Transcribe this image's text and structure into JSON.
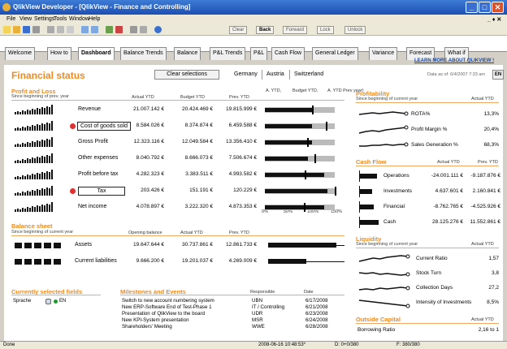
{
  "window": {
    "title": "QlikView Developer - [QlikView - Finance and Controlling]"
  },
  "menu": [
    "File",
    "View",
    "Settings",
    "Tools",
    "Window",
    "Help"
  ],
  "toolbar": {
    "clear": "Clear",
    "back": "Back",
    "forward": "Forward",
    "lock": "Lock",
    "unlock": "Unlock"
  },
  "tabs": [
    "Welcome",
    "How to",
    "Dashboard",
    "Balance Trends",
    "Balance",
    "P&L Trends",
    "P&L",
    "Cash Flow",
    "General Ledger",
    "Variance",
    "Forecast",
    "What if"
  ],
  "learn_more": "LEARN MORE ABOUT QLIKVIEW !",
  "header": {
    "title": "Financial status",
    "clear_btn": "Clear selections",
    "countries": [
      "Germany",
      "Austria",
      "Switzerland"
    ],
    "date_as_of": "Data as of: 6/4/2007 7:33 am",
    "lang": "EN"
  },
  "pl": {
    "title": "Profit and Loss",
    "subtitle": "Since beginning of prev. year",
    "cols": [
      "Actual YTD",
      "Budget YTD",
      "Prev. YTD"
    ],
    "legend": [
      "A. YTD,",
      "Budget YTD,",
      "A. YTD Prev year)"
    ],
    "rows": [
      {
        "label": "Revenue",
        "actual": "21.007.142 €",
        "budget": "20.424.469 €",
        "prev": "19.815.999 €",
        "pct": 1.03,
        "mk": 1.01
      },
      {
        "label": "Cost of goods sold",
        "actual": "8.584.026 €",
        "budget": "8.374.874 €",
        "prev": "6.459.588 €",
        "pct": 1.02,
        "mk": 1.3
      },
      {
        "label": "Gross Profit",
        "actual": "12.323.116 €",
        "budget": "12.049.584 €",
        "prev": "13.356.410 €",
        "pct": 1.02,
        "mk": 0.9
      },
      {
        "label": "Other expenses",
        "actual": "8.040.792 €",
        "budget": "8.666.073 €",
        "prev": "7.506.674 €",
        "pct": 0.93,
        "mk": 1.07
      },
      {
        "label": "Profit before tax",
        "actual": "4.282.323 €",
        "budget": "3.383.511 €",
        "prev": "4.993.582 €",
        "pct": 1.27,
        "mk": 0.86
      },
      {
        "label": "Tax",
        "actual": "203.426 €",
        "budget": "151.191 €",
        "prev": "120.229 €",
        "pct": 1.35,
        "mk": 1.68
      },
      {
        "label": "Net income",
        "actual": "4.078.897 €",
        "budget": "3.222.320 €",
        "prev": "4.873.353 €",
        "pct": 1.27,
        "mk": 0.84
      }
    ],
    "axis": [
      "0%",
      "50%",
      "100%",
      "150%"
    ]
  },
  "balance": {
    "title": "Balance sheet",
    "subtitle": "Since beginning of current year",
    "cols": [
      "Opening balance",
      "Actual YTD",
      "Prev. YTD"
    ],
    "rows": [
      {
        "label": "Assets",
        "opening": "19.647.644 €",
        "actual": "30.737.861 €",
        "prev": "12.861.733 €",
        "v": 0.56
      },
      {
        "label": "Current liabilities",
        "opening": "9.666.200 €",
        "actual": "19.201.037 €",
        "prev": "4.269.009 €",
        "v": 0.31
      }
    ]
  },
  "profitability": {
    "title": "Profitability",
    "subtitle": "Since beginning of current year",
    "col": "Actual YTD",
    "rows": [
      {
        "label": "ROTA%",
        "value": "13,3%"
      },
      {
        "label": "Profit Margin %",
        "value": "20,4%"
      },
      {
        "label": "Sales Generation %",
        "value": "68,3%"
      }
    ]
  },
  "cashflow": {
    "title": "Cash Flow",
    "cols": [
      "Actual YTD",
      "Prev. YTD"
    ],
    "rows": [
      {
        "label": "Operations",
        "actual": "-24.001.111 €",
        "prev": "-9.187.876 €"
      },
      {
        "label": "Investments",
        "actual": "4.637.601 €",
        "prev": "2.160.841 €"
      },
      {
        "label": "Financial",
        "actual": "-8.762.765 €",
        "prev": "-4.525.926 €"
      },
      {
        "label": "Cash",
        "actual": "28.125.276 €",
        "prev": "11.552.861 €"
      }
    ]
  },
  "liquidity": {
    "title": "Liquidity",
    "subtitle": "Since beginning of current year",
    "col": "Actual YTD",
    "rows": [
      {
        "label": "Current Ratio",
        "value": "1,57"
      },
      {
        "label": "Stock Turn",
        "value": "3,8"
      },
      {
        "label": "Collection Days",
        "value": "27,2"
      },
      {
        "label": "Intensity of Investments",
        "value": "8,5%"
      }
    ]
  },
  "outside": {
    "title": "Outside Capital",
    "col": "Actual YTD",
    "rows": [
      {
        "label": "Borrowing Ratio",
        "value": "2,16 to 1"
      }
    ]
  },
  "selected": {
    "title": "Currently selected fields",
    "field": "Sprache",
    "value": "EN"
  },
  "milestones": {
    "title": "Milestones and Events",
    "cols": [
      "Responsible",
      "Date"
    ],
    "rows": [
      {
        "event": "Switch to new account numbering system",
        "resp": "UBN",
        "date": "6/17/2008"
      },
      {
        "event": "New ERP-Software End of Test-Phase 1",
        "resp": "IT / Controlling",
        "date": "6/21/2008"
      },
      {
        "event": "Presentation of QlikView to the board",
        "resp": "UDR",
        "date": "6/23/2008"
      },
      {
        "event": "New KPI-System presentation",
        "resp": "MSR",
        "date": "6/24/2008"
      },
      {
        "event": "Shareholders' Meeting",
        "resp": "WWE",
        "date": "6/28/2008"
      }
    ]
  },
  "status": {
    "left": "Done",
    "timestamp": "2008-06-16 10:48:53*",
    "d": "D: 0+0/380",
    "f": "F: 380/380"
  }
}
